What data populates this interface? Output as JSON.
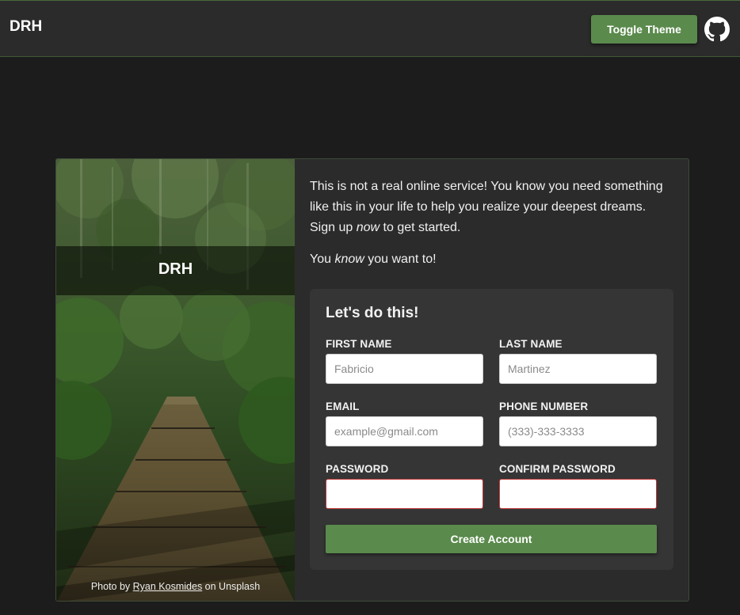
{
  "header": {
    "brand": "DRH",
    "toggle_label": "Toggle Theme",
    "github_icon": "github-icon"
  },
  "photo": {
    "title": "DRH",
    "credit_prefix": "Photo by ",
    "credit_author": "Ryan Kosmides",
    "credit_suffix": " on Unsplash"
  },
  "intro": {
    "p1_a": "This is not a real online service! You know you need something like this in your life to help you realize your deepest dreams. Sign up ",
    "p1_em": "now",
    "p1_b": " to get started.",
    "p2_a": "You ",
    "p2_em": "know",
    "p2_b": " you want to!"
  },
  "form": {
    "title": "Let's do this!",
    "fields": {
      "first_name": {
        "label": "FIRST NAME",
        "placeholder": "Fabricio"
      },
      "last_name": {
        "label": "LAST NAME",
        "placeholder": "Martinez"
      },
      "email": {
        "label": "EMAIL",
        "placeholder": "example@gmail.com"
      },
      "phone": {
        "label": "PHONE NUMBER",
        "placeholder": "(333)-333-3333"
      },
      "password": {
        "label": "PASSWORD",
        "placeholder": ""
      },
      "confirm_password": {
        "label": "CONFIRM PASSWORD",
        "placeholder": ""
      }
    },
    "submit_label": "Create Account"
  },
  "colors": {
    "accent": "#5a8a4c",
    "background": "#1c1c1c",
    "panel": "#2b2b2b",
    "invalid_border": "#c33a3a"
  }
}
